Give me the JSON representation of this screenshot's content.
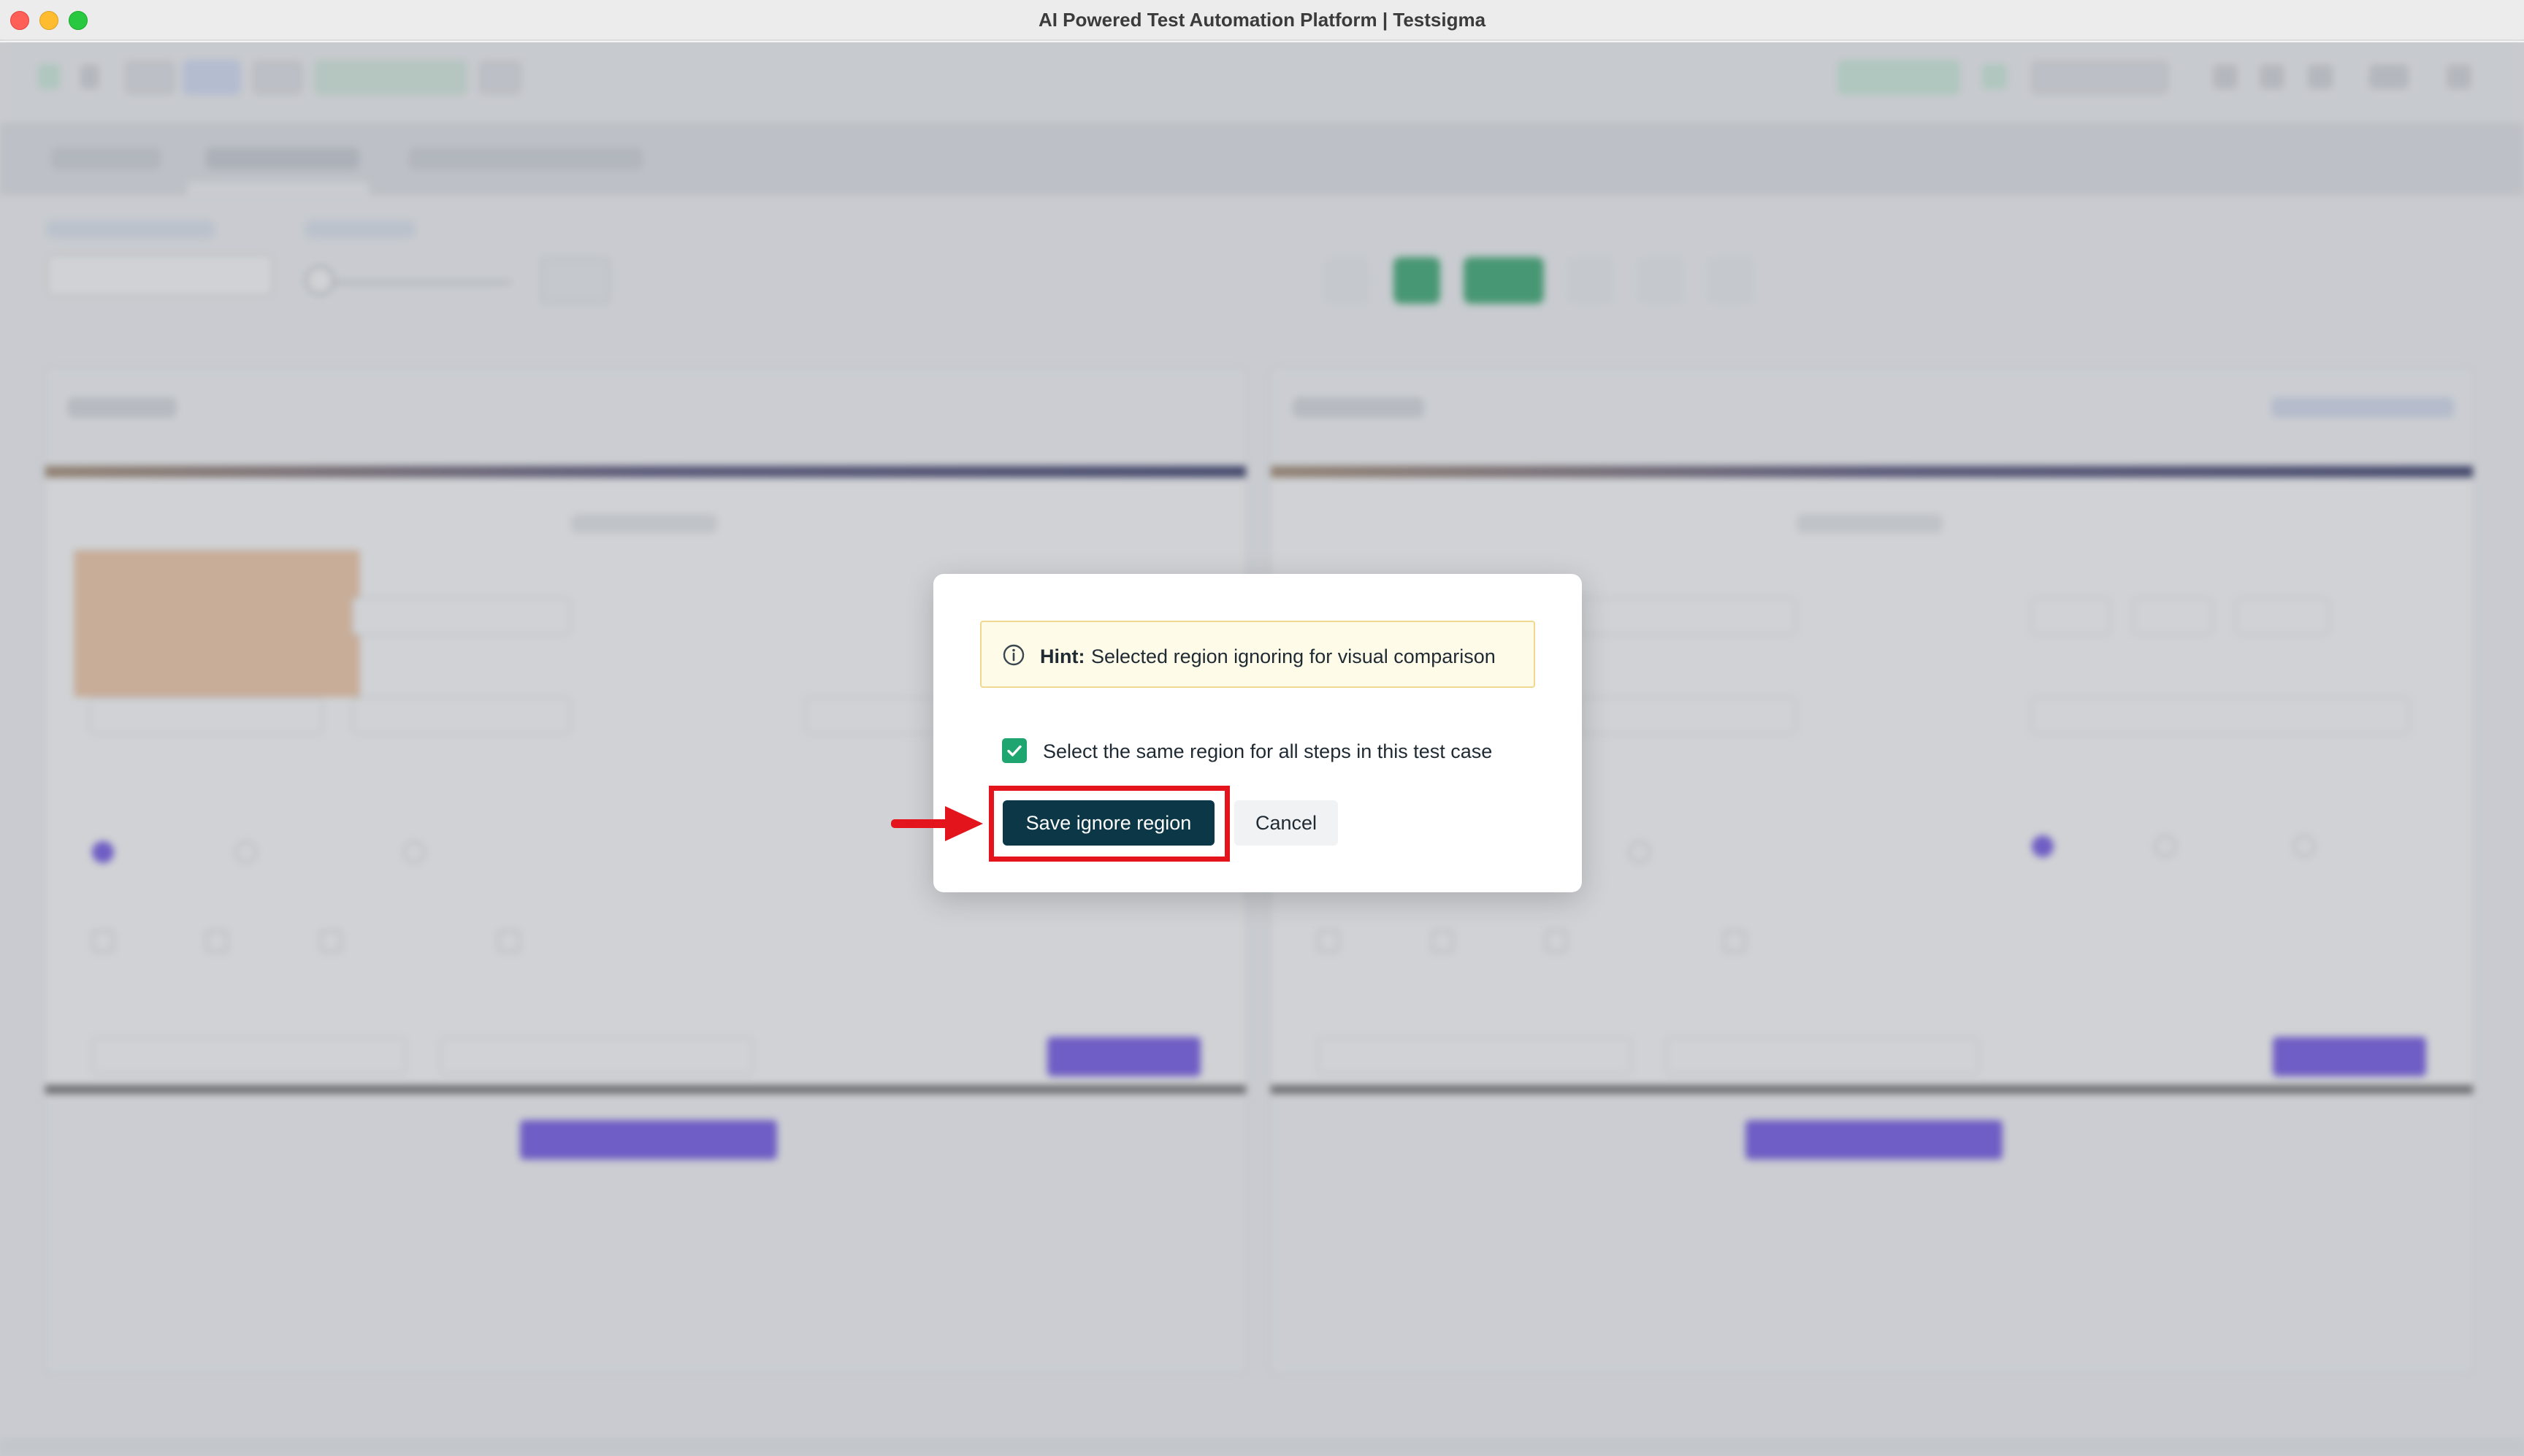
{
  "window": {
    "title": "AI Powered Test Automation Platform | Testsigma"
  },
  "modal": {
    "hint_label": "Hint:",
    "hint_text": "Selected region ignoring for visual comparison",
    "checkbox_label": "Select the same region for all steps in this test case",
    "checkbox_checked": true,
    "save_label": "Save ignore region",
    "cancel_label": "Cancel"
  },
  "colors": {
    "save_button": "#0c3747",
    "checkbox": "#1fa570",
    "highlight": "#e3141c",
    "hint_background": "#fefbe8"
  },
  "icons": {
    "hint": "info-icon",
    "check": "checkmark-icon",
    "annotation": "red-arrow-icon"
  }
}
